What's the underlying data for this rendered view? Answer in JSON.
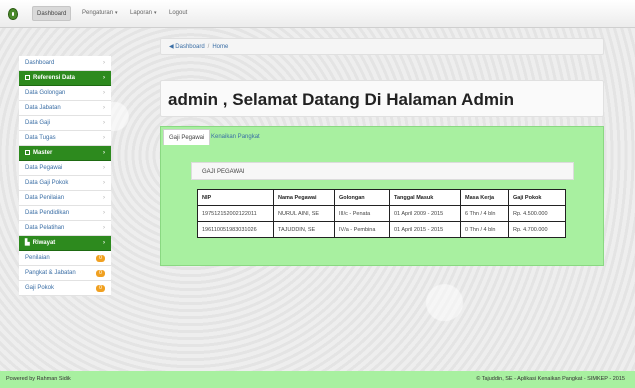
{
  "navbar": {
    "items": [
      {
        "label": "Dashboard"
      },
      {
        "label": "Pengaturan"
      },
      {
        "label": "Laporan"
      },
      {
        "label": "Logout"
      }
    ]
  },
  "sidebar": {
    "items": [
      {
        "label": "Dashboard"
      },
      {
        "label": "Referensi Data"
      },
      {
        "label": "Data Golongan"
      },
      {
        "label": "Data Jabatan"
      },
      {
        "label": "Data Gaji"
      },
      {
        "label": "Data Tugas"
      },
      {
        "label": "Master"
      },
      {
        "label": "Data Pegawai"
      },
      {
        "label": "Data Gaji Pokok"
      },
      {
        "label": "Data Penilaian"
      },
      {
        "label": "Data Pendidikan"
      },
      {
        "label": "Data Pelatihan"
      },
      {
        "label": "Riwayat"
      },
      {
        "label": "Penilaian",
        "badge": "0"
      },
      {
        "label": "Pangkat & Jabatan",
        "badge": "0"
      },
      {
        "label": "Gaji Pokok",
        "badge": "0"
      }
    ]
  },
  "breadcrumb": {
    "items": [
      "Dashboard",
      "Home"
    ]
  },
  "welcome": {
    "title": "admin , Selamat Datang Di Halaman Admin"
  },
  "tabs": [
    {
      "label": "Gaji Pegawai"
    },
    {
      "label": "Kenaikan Pangkat"
    }
  ],
  "panel": {
    "title": "GAJI PEGAWAI"
  },
  "table": {
    "headers": [
      "NIP",
      "Nama Pegawai",
      "Golongan",
      "Tanggal Masuk",
      "Masa Kerja",
      "Gaji Pokok"
    ],
    "rows": [
      [
        "197512152002122011",
        "NURUL AINI, SE",
        "III/c - Penata",
        "01 April 2009 - 2015",
        "6 Thn / 4 bln",
        "Rp. 4.500.000"
      ],
      [
        "196110051983031026",
        "TAJUDDIN, SE",
        "IV/a - Pembina",
        "01 April 2015 - 2015",
        "0 Thn / 4 bln",
        "Rp. 4.700.000"
      ]
    ]
  },
  "footer": {
    "left": "Powered by Rahman Sidik",
    "right": "© Tajuddin, SE - Aplikasi Kenaikan Pangkat - SIMKEP - 2015"
  },
  "colors": {
    "accent_green": "#2d8a1e",
    "panel_green": "#a8f0a0",
    "link_blue": "#3a6ea5",
    "badge_orange": "#f0a020"
  }
}
